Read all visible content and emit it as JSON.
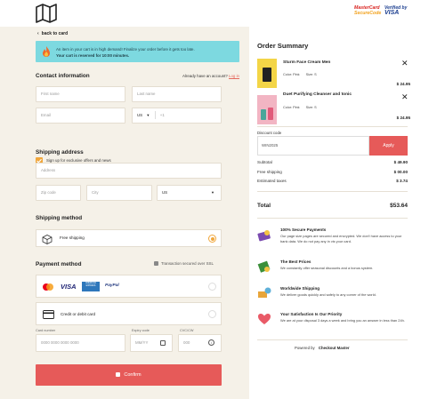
{
  "header": {
    "mastercard_line1": "MasterCard",
    "mastercard_line2": "SecureCode",
    "verified_line1": "Verified by",
    "verified_line2": "VISA"
  },
  "checkout": {
    "back_label": "back to card",
    "alert": {
      "line1": "An item in your cart is in high demand! Finalize your order before it gets too late.",
      "line2": "Your cart is reserved for 10:00 minutes."
    },
    "contact": {
      "title": "Contact information",
      "account_prompt": "Already have an account?",
      "login_label": "Log in",
      "first_name_placeholder": "First name",
      "last_name_placeholder": "Last name",
      "email_placeholder": "Email",
      "country_code": "US",
      "phone_prefix": "+1",
      "newsletter_label": "Sign up for exclusive offers and news"
    },
    "shipping_address": {
      "title": "Shipping address",
      "address_placeholder": "Address",
      "zip_placeholder": "Zip code",
      "city_placeholder": "City",
      "country": "US"
    },
    "shipping_method": {
      "title": "Shipping method",
      "option_label": "Free shipping"
    },
    "payment": {
      "title": "Payment method",
      "secure_note": "Transaction secured over SSL",
      "card_option_label": "Credit or debit card",
      "brand_visa": "VISA",
      "brand_amex": "AMERICAN EXPRESS",
      "brand_paypal": "PayPal",
      "card_number_label": "Card number",
      "card_number_placeholder": "0000  0000  0000  0000",
      "expiry_label": "Expiry code",
      "expiry_placeholder": "MM/YY",
      "cvc_label": "CVC/CW",
      "cvc_placeholder": "000"
    },
    "confirm_label": "Confirm"
  },
  "summary": {
    "title": "Order Summary",
    "products": [
      {
        "name": "Sturm Face Cream Men",
        "color": "Color: Pink",
        "size": "Size: S",
        "price": "$ 24.95"
      },
      {
        "name": "Duet Purifying Cleanser and tonic",
        "color": "Color: Pink",
        "size": "Size: S",
        "price": "$ 24.95"
      }
    ],
    "discount_label": "Discount code",
    "discount_value": "WIN2025",
    "apply_label": "Apply",
    "rows": [
      {
        "label": "Subtotal",
        "value": "$ 49.90"
      },
      {
        "label": "Free shipping",
        "value": "$ 00.00"
      },
      {
        "label": "Estimated taxes",
        "value": "$ 3.74"
      }
    ],
    "total_label": "Total",
    "total_value": "$53.64",
    "features": [
      {
        "title": "100% Secure Payments",
        "desc": "Our page size pages are secured and encrypted. We don't have access to your bank data. We do not pay any in vis your card."
      },
      {
        "title": "The Best Prices",
        "desc": "We constantly offer seasonal discounts and a bonus system."
      },
      {
        "title": "Worldwide Shipping",
        "desc": "We deliver goods quickly and safely to any corner of the world."
      },
      {
        "title": "Your Satisfaction Is Our Priority",
        "desc": "We are at your disposal 3 days a week and bring you an answer in less than 24h."
      }
    ],
    "powered_by": "Powered by",
    "powered_brand": "Checkout Master"
  },
  "colors": {
    "accent": "#e65a59",
    "orange": "#f0a63b",
    "alert_bg": "#7dd9e0",
    "left_bg": "#f5f1e8"
  },
  "icons": [
    "map-logo-icon",
    "arrow-left-icon",
    "flame-icon",
    "checkmark-icon",
    "chevron-down-icon",
    "truck-box-icon",
    "lock-icon",
    "credit-card-icon",
    "calendar-icon",
    "info-icon",
    "close-icon",
    "shield-icon",
    "money-icon",
    "globe-icon",
    "heart-icon"
  ]
}
